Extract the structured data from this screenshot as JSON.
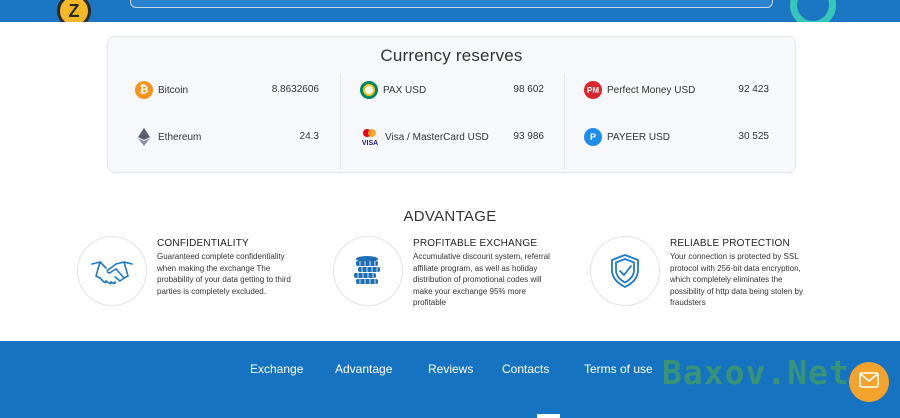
{
  "reserves": {
    "title": "Currency reserves",
    "items": [
      {
        "name": "Bitcoin",
        "amount": "8.8632606",
        "icon": "bitcoin-icon",
        "glyph": "₿",
        "color": "#f7931a"
      },
      {
        "name": "Ethereum",
        "amount": "24.3",
        "icon": "ethereum-icon",
        "color": "#627eea"
      },
      {
        "name": "PAX USD",
        "amount": "98 602",
        "icon": "pax-icon",
        "color": "#00845d"
      },
      {
        "name": "Visa / MasterCard USD",
        "amount": "93 986",
        "icon": "visa-mastercard-icon",
        "glyph": "VISA",
        "color": "#1a1f71"
      },
      {
        "name": "Perfect Money USD",
        "amount": "92 423",
        "icon": "perfect-money-icon",
        "glyph": "PM",
        "color": "#d8262c"
      },
      {
        "name": "PAYEER USD",
        "amount": "30 525",
        "icon": "payeer-icon",
        "glyph": "P",
        "color": "#1f8ee8"
      }
    ]
  },
  "advantage": {
    "title": "ADVANTAGE",
    "items": [
      {
        "title": "CONFIDENTIALITY",
        "text": "Guaranteed complete confidentiality when making the exchange The probability of your data getting to third parties is completely excluded.",
        "icon": "handshake-icon"
      },
      {
        "title": "PROFITABLE EXCHANGE",
        "text": "Accumulative discount system, referral affiliate program, as well as holiday distribution of promotional codes will make your exchange 95% more profitable",
        "icon": "coins-icon"
      },
      {
        "title": "RELIABLE PROTECTION",
        "text": "Your connection is protected by SSL protocol with 256-bit data encryption, which completely eliminates the possibility of http data being stolen by fraudsters",
        "icon": "shield-check-icon"
      }
    ]
  },
  "footer": {
    "nav": [
      "Exchange",
      "Advantage",
      "Reviews",
      "Contacts",
      "Terms of use"
    ],
    "watermark": "Baxov.Net",
    "mail_icon": "mail-icon"
  },
  "top": {
    "coin_glyph": "Z"
  },
  "colors": {
    "brand_blue": "#1673c2",
    "accent_orange": "#f3a32c",
    "icon_blue": "#1f78c8"
  }
}
